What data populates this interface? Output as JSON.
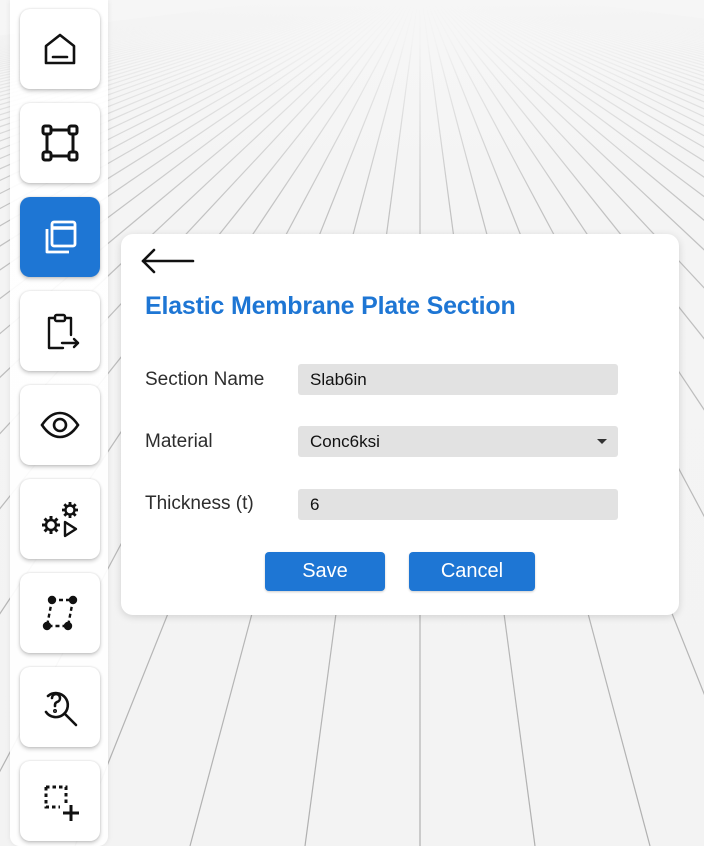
{
  "toolbar": {
    "items": [
      {
        "icon": "home-icon",
        "active": false
      },
      {
        "icon": "bounding-square-icon",
        "active": false
      },
      {
        "icon": "stacked-layers-icon",
        "active": true
      },
      {
        "icon": "clipboard-export-icon",
        "active": false
      },
      {
        "icon": "eye-icon",
        "active": false
      },
      {
        "icon": "gears-play-icon",
        "active": false
      },
      {
        "icon": "parallelogram-nodes-icon",
        "active": false
      },
      {
        "icon": "search-question-icon",
        "active": false
      },
      {
        "icon": "dashed-select-add-icon",
        "active": false
      }
    ]
  },
  "panel": {
    "back_icon": "back-arrow-icon",
    "title": "Elastic Membrane Plate Section",
    "fields": {
      "section_name": {
        "label": "Section Name",
        "value": "Slab6in"
      },
      "material": {
        "label": "Material",
        "value": "Conc6ksi"
      },
      "thickness": {
        "label": "Thickness (t)",
        "value": "6"
      }
    },
    "save_label": "Save",
    "cancel_label": "Cancel"
  },
  "colors": {
    "accent": "#1e76d4",
    "input_bg": "#e2e2e2",
    "background": "#f3f3f3"
  }
}
